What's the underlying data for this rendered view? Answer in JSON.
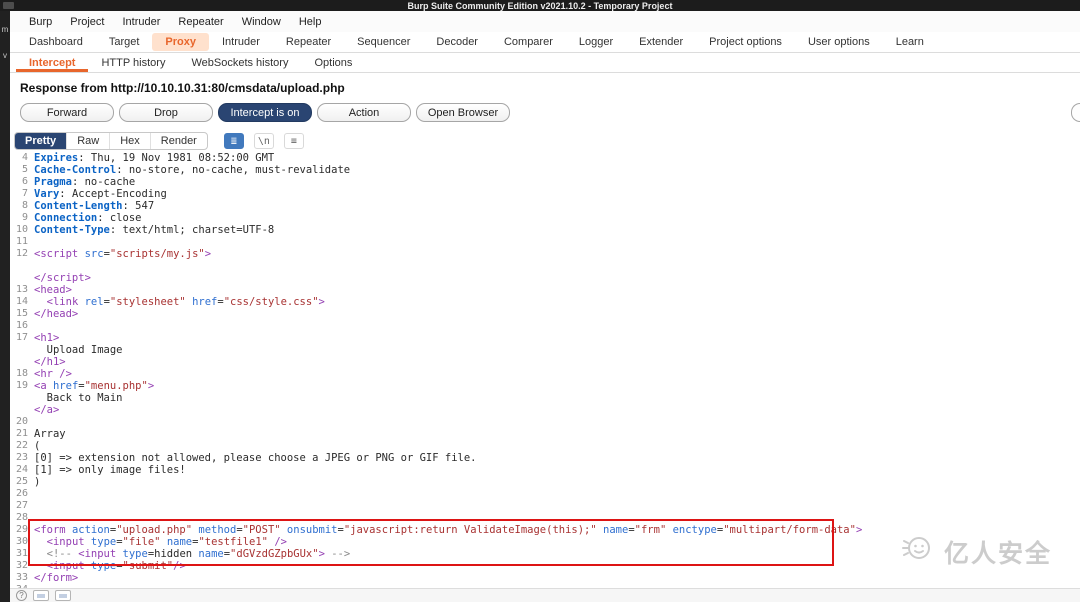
{
  "title_bar": {
    "title": "Burp Suite Community Edition v2021.10.2 - Temporary Project"
  },
  "menu_bar": {
    "items": [
      "Burp",
      "Project",
      "Intruder",
      "Repeater",
      "Window",
      "Help"
    ]
  },
  "main_tabs": {
    "items": [
      {
        "label": "Dashboard",
        "active": false
      },
      {
        "label": "Target",
        "active": false
      },
      {
        "label": "Proxy",
        "active": true
      },
      {
        "label": "Intruder",
        "active": false
      },
      {
        "label": "Repeater",
        "active": false
      },
      {
        "label": "Sequencer",
        "active": false
      },
      {
        "label": "Decoder",
        "active": false
      },
      {
        "label": "Comparer",
        "active": false
      },
      {
        "label": "Logger",
        "active": false
      },
      {
        "label": "Extender",
        "active": false
      },
      {
        "label": "Project options",
        "active": false
      },
      {
        "label": "User options",
        "active": false
      },
      {
        "label": "Learn",
        "active": false
      }
    ]
  },
  "sub_tabs": {
    "items": [
      {
        "label": "Intercept",
        "active": true
      },
      {
        "label": "HTTP history",
        "active": false
      },
      {
        "label": "WebSockets history",
        "active": false
      },
      {
        "label": "Options",
        "active": false
      }
    ]
  },
  "intercept": {
    "info": "Response from http://10.10.10.31:80/cmsdata/upload.php",
    "buttons": {
      "forward": "Forward",
      "drop": "Drop",
      "intercept_toggle": "Intercept is on",
      "action": "Action",
      "open_browser": "Open Browser"
    }
  },
  "editor": {
    "views": [
      "Pretty",
      "Raw",
      "Hex",
      "Render"
    ],
    "active_view": "Pretty",
    "icons": {
      "pretty_settings": "≣",
      "newline": "\\n",
      "menu": "≡"
    }
  },
  "left_strip": {
    "chars": [
      "m",
      "v"
    ]
  },
  "watermark": {
    "text": "亿人安全"
  },
  "status_bar": {
    "help_label": "?"
  },
  "colors": {
    "accent_orange": "#e8662c",
    "toggle_navy": "#2a4572",
    "highlight_red": "#dd1414"
  },
  "code": {
    "rows": [
      {
        "n": "4",
        "s": [
          {
            "t": "Expires",
            "c": "hn"
          },
          {
            "t": ": ",
            "c": "pl"
          },
          {
            "t": "Thu, 19 Nov 1981 08:52:00 GMT",
            "c": "hv"
          }
        ]
      },
      {
        "n": "5",
        "s": [
          {
            "t": "Cache-Control",
            "c": "hn"
          },
          {
            "t": ": ",
            "c": "pl"
          },
          {
            "t": "no-store, no-cache, must-revalidate",
            "c": "hv"
          }
        ]
      },
      {
        "n": "6",
        "s": [
          {
            "t": "Pragma",
            "c": "hn"
          },
          {
            "t": ": ",
            "c": "pl"
          },
          {
            "t": "no-cache",
            "c": "hv"
          }
        ]
      },
      {
        "n": "7",
        "s": [
          {
            "t": "Vary",
            "c": "hn"
          },
          {
            "t": ": ",
            "c": "pl"
          },
          {
            "t": "Accept-Encoding",
            "c": "hv"
          }
        ]
      },
      {
        "n": "8",
        "s": [
          {
            "t": "Content-Length",
            "c": "hn"
          },
          {
            "t": ": ",
            "c": "pl"
          },
          {
            "t": "547",
            "c": "hv"
          }
        ]
      },
      {
        "n": "9",
        "s": [
          {
            "t": "Connection",
            "c": "hn"
          },
          {
            "t": ": ",
            "c": "pl"
          },
          {
            "t": "close",
            "c": "hv"
          }
        ]
      },
      {
        "n": "10",
        "s": [
          {
            "t": "Content-Type",
            "c": "hn"
          },
          {
            "t": ": ",
            "c": "pl"
          },
          {
            "t": "text/html; charset=UTF-8",
            "c": "hv"
          }
        ]
      },
      {
        "n": "11",
        "s": []
      },
      {
        "n": "12",
        "s": [
          {
            "t": "<script",
            "c": "tag"
          },
          {
            "t": " ",
            "c": "pl"
          },
          {
            "t": "src",
            "c": "attr"
          },
          {
            "t": "=",
            "c": "pl"
          },
          {
            "t": "\"scripts/my.js\"",
            "c": "str"
          },
          {
            "t": ">",
            "c": "tag"
          }
        ]
      },
      {
        "n": "",
        "s": []
      },
      {
        "n": "",
        "s": [
          {
            "t": "</script>",
            "c": "tag"
          }
        ]
      },
      {
        "n": "13",
        "s": [
          {
            "t": "<head>",
            "c": "tag"
          }
        ]
      },
      {
        "n": "14",
        "s": [
          {
            "t": "  ",
            "c": "pl"
          },
          {
            "t": "<link",
            "c": "tag"
          },
          {
            "t": " ",
            "c": "pl"
          },
          {
            "t": "rel",
            "c": "attr"
          },
          {
            "t": "=",
            "c": "pl"
          },
          {
            "t": "\"stylesheet\"",
            "c": "str"
          },
          {
            "t": " ",
            "c": "pl"
          },
          {
            "t": "href",
            "c": "attr"
          },
          {
            "t": "=",
            "c": "pl"
          },
          {
            "t": "\"css/style.css\"",
            "c": "str"
          },
          {
            "t": ">",
            "c": "tag"
          }
        ]
      },
      {
        "n": "15",
        "s": [
          {
            "t": "</head>",
            "c": "tag"
          }
        ]
      },
      {
        "n": "16",
        "s": []
      },
      {
        "n": "17",
        "s": [
          {
            "t": "<h1>",
            "c": "tag"
          }
        ]
      },
      {
        "n": "",
        "s": [
          {
            "t": "  Upload Image",
            "c": "pl"
          }
        ]
      },
      {
        "n": "",
        "s": [
          {
            "t": "</h1>",
            "c": "tag"
          }
        ]
      },
      {
        "n": "18",
        "s": [
          {
            "t": "<hr />",
            "c": "tag"
          }
        ]
      },
      {
        "n": "19",
        "s": [
          {
            "t": "<a",
            "c": "tag"
          },
          {
            "t": " ",
            "c": "pl"
          },
          {
            "t": "href",
            "c": "attr"
          },
          {
            "t": "=",
            "c": "pl"
          },
          {
            "t": "\"menu.php\"",
            "c": "str"
          },
          {
            "t": ">",
            "c": "tag"
          }
        ]
      },
      {
        "n": "",
        "s": [
          {
            "t": "  Back to Main",
            "c": "pl"
          }
        ]
      },
      {
        "n": "",
        "s": [
          {
            "t": "</a>",
            "c": "tag"
          }
        ]
      },
      {
        "n": "20",
        "s": []
      },
      {
        "n": "21",
        "s": [
          {
            "t": "Array",
            "c": "pl"
          }
        ]
      },
      {
        "n": "22",
        "s": [
          {
            "t": "(",
            "c": "pl"
          }
        ]
      },
      {
        "n": "23",
        "s": [
          {
            "t": "[0] => extension not allowed, please choose a JPEG or PNG or GIF file.",
            "c": "pl"
          }
        ]
      },
      {
        "n": "24",
        "s": [
          {
            "t": "[1] => only image files!",
            "c": "pl"
          }
        ]
      },
      {
        "n": "25",
        "s": [
          {
            "t": ")",
            "c": "pl"
          }
        ]
      },
      {
        "n": "26",
        "s": []
      },
      {
        "n": "27",
        "s": []
      },
      {
        "n": "28",
        "s": []
      },
      {
        "n": "29",
        "s": [
          {
            "t": "<form",
            "c": "tag"
          },
          {
            "t": " ",
            "c": "pl"
          },
          {
            "t": "action",
            "c": "attr"
          },
          {
            "t": "=",
            "c": "pl"
          },
          {
            "t": "\"upload.php\"",
            "c": "str"
          },
          {
            "t": " ",
            "c": "pl"
          },
          {
            "t": "method",
            "c": "attr"
          },
          {
            "t": "=",
            "c": "pl"
          },
          {
            "t": "\"POST\"",
            "c": "str"
          },
          {
            "t": " ",
            "c": "pl"
          },
          {
            "t": "onsubmit",
            "c": "attr"
          },
          {
            "t": "=",
            "c": "pl"
          },
          {
            "t": "\"javascript:return ValidateImage(this);\"",
            "c": "str"
          },
          {
            "t": " ",
            "c": "pl"
          },
          {
            "t": "name",
            "c": "attr"
          },
          {
            "t": "=",
            "c": "pl"
          },
          {
            "t": "\"frm\"",
            "c": "str"
          },
          {
            "t": " ",
            "c": "pl"
          },
          {
            "t": "enctype",
            "c": "attr"
          },
          {
            "t": "=",
            "c": "pl"
          },
          {
            "t": "\"multipart/form-data\"",
            "c": "str"
          },
          {
            "t": ">",
            "c": "tag"
          }
        ]
      },
      {
        "n": "30",
        "s": [
          {
            "t": "  ",
            "c": "pl"
          },
          {
            "t": "<input",
            "c": "tag"
          },
          {
            "t": " ",
            "c": "pl"
          },
          {
            "t": "type",
            "c": "attr"
          },
          {
            "t": "=",
            "c": "pl"
          },
          {
            "t": "\"file\"",
            "c": "str"
          },
          {
            "t": " ",
            "c": "pl"
          },
          {
            "t": "name",
            "c": "attr"
          },
          {
            "t": "=",
            "c": "pl"
          },
          {
            "t": "\"testfile1\"",
            "c": "str"
          },
          {
            "t": " ",
            "c": "pl"
          },
          {
            "t": "/>",
            "c": "tag"
          }
        ]
      },
      {
        "n": "31",
        "s": [
          {
            "t": "  ",
            "c": "pl"
          },
          {
            "t": "<!-- ",
            "c": "comm"
          },
          {
            "t": "<input",
            "c": "tag"
          },
          {
            "t": " ",
            "c": "pl"
          },
          {
            "t": "type",
            "c": "attr"
          },
          {
            "t": "=",
            "c": "pl"
          },
          {
            "t": "hidden",
            "c": "pl"
          },
          {
            "t": " ",
            "c": "pl"
          },
          {
            "t": "name",
            "c": "attr"
          },
          {
            "t": "=",
            "c": "pl"
          },
          {
            "t": "\"dGVzdGZpbGUx\"",
            "c": "str"
          },
          {
            "t": ">",
            "c": "tag"
          },
          {
            "t": " -->",
            "c": "comm"
          }
        ]
      },
      {
        "n": "32",
        "s": [
          {
            "t": "  ",
            "c": "pl"
          },
          {
            "t": "<input",
            "c": "tag"
          },
          {
            "t": " ",
            "c": "pl"
          },
          {
            "t": "type",
            "c": "attr"
          },
          {
            "t": "=",
            "c": "pl"
          },
          {
            "t": "\"submit\"",
            "c": "str"
          },
          {
            "t": "/>",
            "c": "tag"
          }
        ]
      },
      {
        "n": "33",
        "s": [
          {
            "t": "</form>",
            "c": "tag"
          }
        ]
      },
      {
        "n": "34",
        "s": []
      }
    ]
  }
}
